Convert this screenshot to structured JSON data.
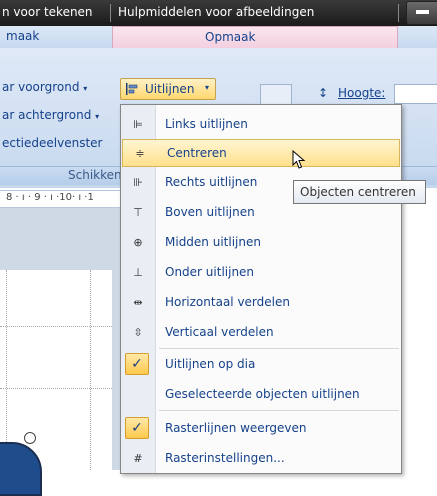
{
  "title_bar": {
    "tab_left": "n voor tekenen",
    "tab_context": "Hulpmiddelen voor afbeeldingen"
  },
  "ribbon_tabs": {
    "left_tab": "maak",
    "context_tab": "Opmaak"
  },
  "ribbon": {
    "bring_forward": "ar voorgrond",
    "send_backward": "ar achtergrond",
    "selection_pane": "ectiedeelvenster",
    "align_button": "Uitlijnen",
    "height_label": "Hoogte:",
    "group_label": "Schikken"
  },
  "ruler": {
    "text": "8 · ı · 9 · ı ·10· ı ·1"
  },
  "menu": {
    "items": [
      {
        "label": "Links uitlijnen",
        "icon": "align-left-icon"
      },
      {
        "label": "Centreren",
        "icon": "align-center-icon",
        "highlighted": true
      },
      {
        "label": "Rechts uitlijnen",
        "icon": "align-right-icon"
      },
      {
        "label": "Boven uitlijnen",
        "icon": "align-top-icon"
      },
      {
        "label": "Midden uitlijnen",
        "icon": "align-middle-icon"
      },
      {
        "label": "Onder uitlijnen",
        "icon": "align-bottom-icon"
      },
      {
        "label": "Horizontaal verdelen",
        "icon": "distribute-horizontal-icon"
      },
      {
        "label": "Verticaal verdelen",
        "icon": "distribute-vertical-icon"
      },
      {
        "label": "Uitlijnen op dia",
        "icon": "checkmark-icon",
        "checked": true
      },
      {
        "label": "Geselecteerde objecten uitlijnen",
        "icon": ""
      },
      {
        "label": "Rasterlijnen weergeven",
        "icon": "checkmark-icon",
        "checked": true
      },
      {
        "label": "Rasterinstellingen...",
        "icon": "grid-icon"
      }
    ]
  },
  "tooltip": {
    "text": "Objecten centreren"
  },
  "colors": {
    "highlight": "#ffe18c",
    "text": "#15428b",
    "titlebar": "#1a1a1a"
  }
}
